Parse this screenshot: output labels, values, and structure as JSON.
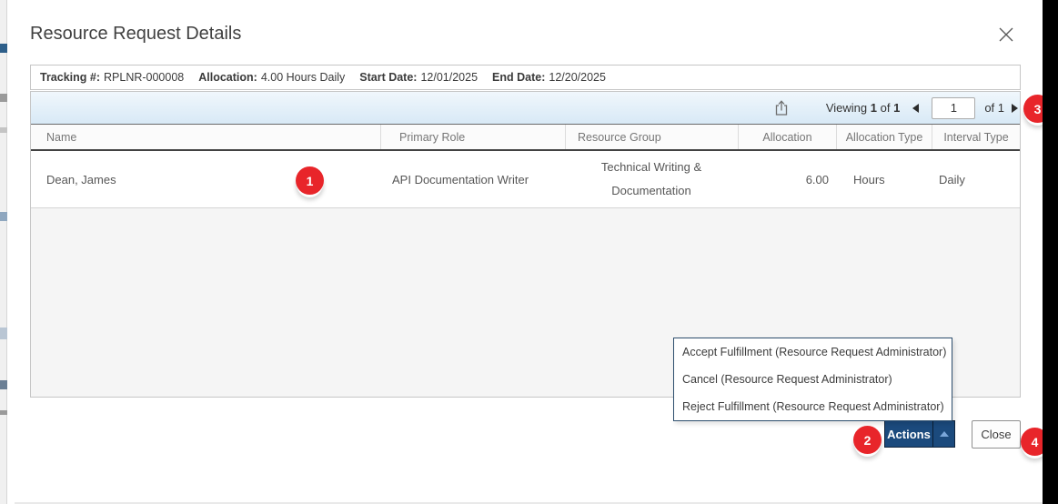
{
  "modal": {
    "title": "Resource Request Details"
  },
  "summary_bar": {
    "fields": [
      {
        "label": "Tracking #:",
        "value": "RPLNR-000008"
      },
      {
        "label": "Allocation:",
        "value": "4.00 Hours Daily"
      },
      {
        "label": "Start Date:",
        "value": "12/01/2025"
      },
      {
        "label": "End Date:",
        "value": "12/20/2025"
      }
    ]
  },
  "toolbar": {
    "export_icon": "export-icon",
    "viewing_label": "Viewing",
    "viewing_current": "1",
    "viewing_of": "of",
    "viewing_total": "1",
    "pager": {
      "prev_icon": "chevron-left-icon",
      "page_value": "1",
      "of_label": "of 1",
      "next_icon": "chevron-right-icon"
    }
  },
  "table": {
    "columns": [
      "Name",
      "Primary Role",
      "Resource Group",
      "Allocation",
      "Allocation Type",
      "Interval Type"
    ],
    "rows": [
      {
        "name": "Dean, James",
        "primary_role": "API Documentation Writer",
        "resource_group": "Technical Writing & Documentation",
        "allocation": "6.00",
        "allocation_type": "Hours",
        "interval_type": "Daily"
      }
    ]
  },
  "actions_menu": {
    "items": [
      "Accept Fulfillment (Resource Request Administrator)",
      "Cancel (Resource Request Administrator)",
      "Reject Fulfillment (Resource Request Administrator)"
    ]
  },
  "footer": {
    "actions_label": "Actions",
    "close_label": "Close"
  },
  "annotations": {
    "badges": [
      {
        "number": "1"
      },
      {
        "number": "2"
      },
      {
        "number": "3"
      },
      {
        "number": "4"
      }
    ]
  },
  "colors": {
    "accent_navy": "#1b4a7d",
    "badge_red": "#e8252a",
    "toolbar_blue_top": "#f0f7fc",
    "toolbar_blue_bottom": "#d8e9f6",
    "dropdown_border": "#2e4f6e",
    "grid_empty_gray": "#f5f5f5"
  }
}
